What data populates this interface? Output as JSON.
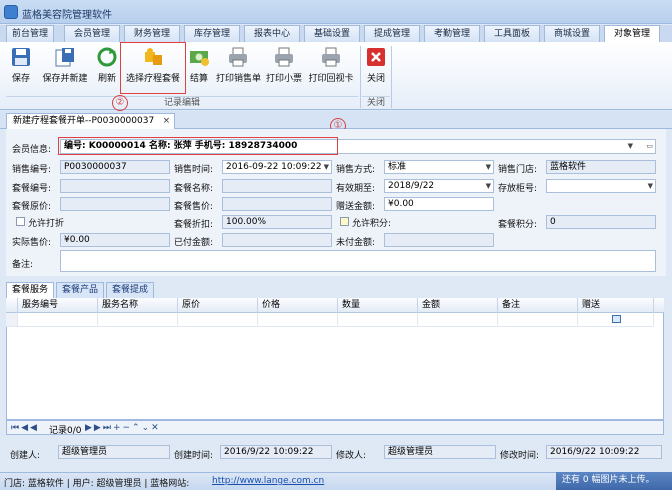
{
  "app": {
    "title": "蓝格美容院管理软件"
  },
  "menu_tabs": [
    "前台管理",
    "会员管理",
    "财务管理",
    "库存管理",
    "报表中心",
    "基础设置",
    "提成管理",
    "考勤管理",
    "工具面板",
    "商城设置",
    "对象管理"
  ],
  "ribbon": {
    "buttons": [
      {
        "label": "保存",
        "icon": "save-icon"
      },
      {
        "label": "保存并新建",
        "icon": "save-new-icon"
      },
      {
        "label": "刷新",
        "icon": "refresh-icon"
      },
      {
        "label": "选择疗程套餐",
        "icon": "puzzle-icon"
      },
      {
        "label": "结算",
        "icon": "money-icon"
      },
      {
        "label": "打印销售单",
        "icon": "printer-icon"
      },
      {
        "label": "打印小票",
        "icon": "printer-icon"
      },
      {
        "label": "打印回视卡",
        "icon": "printer-icon"
      },
      {
        "label": "关闭",
        "icon": "close-icon"
      }
    ],
    "group1": "记录编辑",
    "group2": "关闭"
  },
  "annotations": {
    "one": "①",
    "two": "②"
  },
  "doc_tab": {
    "title": "新建疗程套餐开单--P0030000037",
    "close": "×"
  },
  "form": {
    "member_label": "会员信息:",
    "member_value": "编号: K00000014  名称: 张萍   手机号: 18928734000",
    "sale_no_label": "销售编号:",
    "sale_no": "P0030000037",
    "sale_time_label": "销售时间:",
    "sale_time": "2016-09-22 10:09:22",
    "sale_method_label": "销售方式:",
    "sale_method": "标准",
    "store_label": "销售门店:",
    "store": "蓝格软件",
    "pkg_no_label": "套餐编号:",
    "pkg_name_label": "套餐名称:",
    "valid_label": "有效期至:",
    "valid": "2018/9/22",
    "cabinet_label": "存放柜号:",
    "pkg_orig_label": "套餐原价:",
    "pkg_price_label": "套餐售价:",
    "gift_label": "赠送金额:",
    "gift": "¥0.00",
    "allow_discount": "允许打折",
    "discount_label": "套餐折扣:",
    "discount": "100.00%",
    "allow_points": "允许积分:",
    "points_label": "套餐积分:",
    "points": "0",
    "actual_label": "实际售价:",
    "actual": "¥0.00",
    "paid_label": "已付金额:",
    "unpaid_label": "未付金额:",
    "remark_label": "备注:"
  },
  "sub_tabs": [
    "套餐服务",
    "套餐产品",
    "套餐提成"
  ],
  "grid": {
    "columns": [
      "服务编号",
      "服务名称",
      "原价",
      "价格",
      "数量",
      "金额",
      "备注",
      "赠送"
    ]
  },
  "nav": {
    "record": "记录0/0"
  },
  "footer": {
    "creator_label": "创建人:",
    "creator": "超级管理员",
    "created_label": "创建时间:",
    "created": "2016/9/22 10:09:22",
    "modifier_label": "修改人:",
    "modifier": "超级管理员",
    "modified_label": "修改时间:",
    "modified": "2016/9/22 10:09:22"
  },
  "status": {
    "left": "门店: 蓝格软件 | 用户: 超级管理员 | 蓝格网站:",
    "url": "http://www.lange.com.cn",
    "right": "还有 0 幅图片未上传。"
  }
}
